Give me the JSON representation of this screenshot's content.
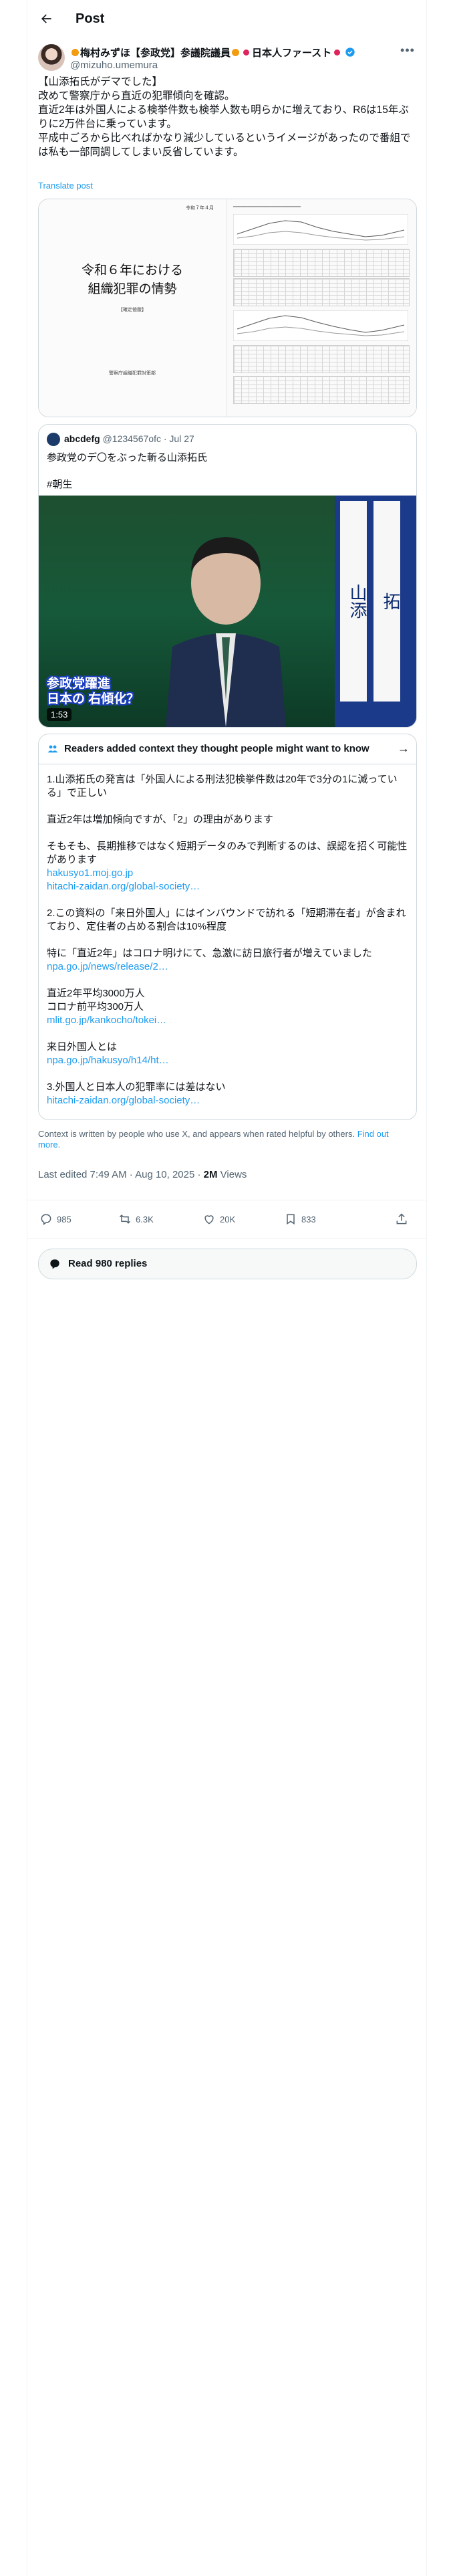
{
  "header": {
    "title": "Post"
  },
  "author": {
    "name_prefix": "梅村みずほ【参政党】参議院議員",
    "name_suffix": "日本人ファースト",
    "handle": "@mizuho.umemura"
  },
  "post": {
    "text": "【山添拓氏がデマでした】\n改めて警察庁から直近の犯罪傾向を確認。\n直近2年は外国人による検挙件数も検挙人数も明らかに増えており、R6は15年ぶりに2万件台に乗っています。\n平成中ごろから比べればかなり減少しているというイメージがあったので番組では私も一部同調してしまい反省しています。",
    "translate_label": "Translate post"
  },
  "media": {
    "doc_date": "令和７年４月",
    "doc_title": "令和６年における\n組織犯罪の情勢",
    "doc_sub": "【確定値版】",
    "doc_footer": "警察庁組織犯罪対策部"
  },
  "quote": {
    "name": "abcdefg",
    "handle": "@1234567ofc",
    "date": "· Jul 27",
    "text": "参政党のデ〇をぶった斬る山添拓氏\n\n#朝生",
    "video_sign_1": "山添",
    "video_sign_2": "拓",
    "video_caption": "参政党躍進\n日本の 右傾化？",
    "video_time": "1:53"
  },
  "notes": {
    "title": "Readers added context they thought people might want to know",
    "paragraphs": [
      "1.山添拓氏の発言は「外国人による刑法犯検挙件数は20年で3分の1に減っている」で正しい",
      "直近2年は増加傾向ですが、「2」の理由があります",
      "そもそも、長期推移ではなく短期データのみで判断するのは、誤認を招く可能性があります",
      "2.この資料の「来日外国人」にはインバウンドで訪れる「短期滞在者」が含まれており、定住者の占める割合は10%程度",
      "特に「直近2年」はコロナ明けにて、急激に訪日旅行者が増えていました",
      "直近2年平均3000万人\nコロナ前平均300万人",
      "来日外国人とは",
      "3.外国人と日本人の犯罪率には差はない"
    ],
    "links": [
      "hakusyo1.moj.go.jp",
      "hitachi-zaidan.org/global-society…",
      "npa.go.jp/news/release/2…",
      "mlit.go.jp/kankocho/tokei…",
      "npa.go.jp/hakusyo/h14/ht…",
      "hitachi-zaidan.org/global-society…"
    ]
  },
  "disclaimer": {
    "text": "Context is written by people who use X, and appears when rated helpful by others.",
    "link": "Find out more."
  },
  "meta": {
    "timestamp": "Last edited 7:49 AM · Aug 10, 2025 · ",
    "views_count": "2M",
    "views_label": " Views"
  },
  "actions": {
    "replies": "985",
    "reposts": "6.3K",
    "likes": "20K",
    "bookmarks": "833"
  },
  "read_replies": "Read 980 replies",
  "icons": {
    "back": "arrow-left-icon",
    "more": "more-horizontal-icon",
    "verified": "verified-badge-icon",
    "reply": "reply-icon",
    "repost": "repost-icon",
    "like": "heart-icon",
    "bookmark": "bookmark-icon",
    "share": "share-icon",
    "notes": "community-notes-icon"
  },
  "colors": {
    "accent": "#1d9bf0",
    "secondary_text": "#536471",
    "border": "#cfd9de"
  }
}
